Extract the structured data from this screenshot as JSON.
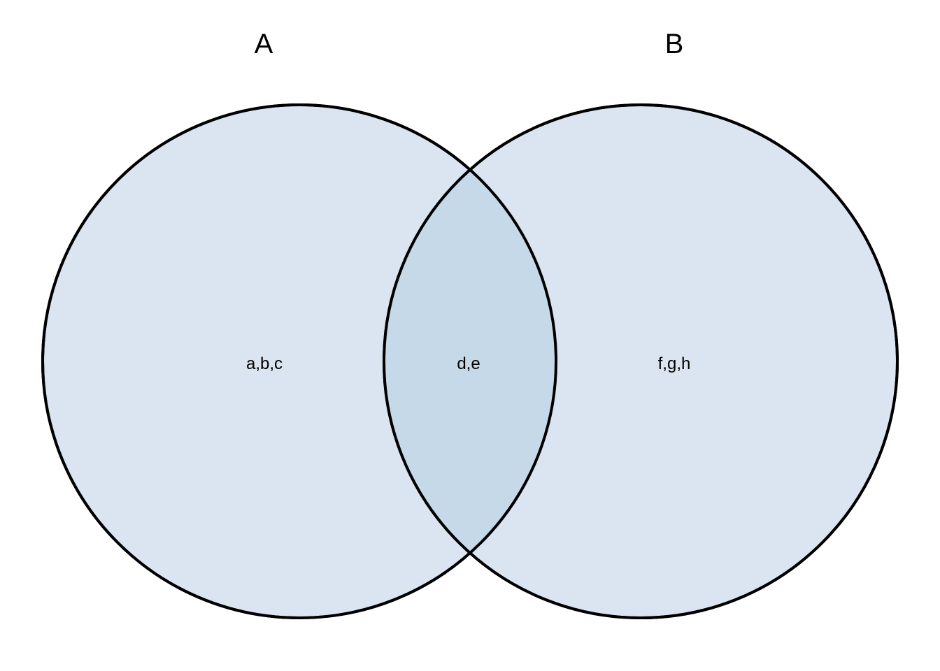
{
  "colors": {
    "set_fill": "#dae5f1",
    "overlap_fill": "#c6d9e9",
    "outline": "#000000",
    "background": "#ffffff"
  },
  "sets": [
    {
      "label": "A",
      "only_elements": "a,b,c"
    },
    {
      "label": "B",
      "only_elements": "f,g,h"
    }
  ],
  "intersection": {
    "elements": "d,e"
  }
}
